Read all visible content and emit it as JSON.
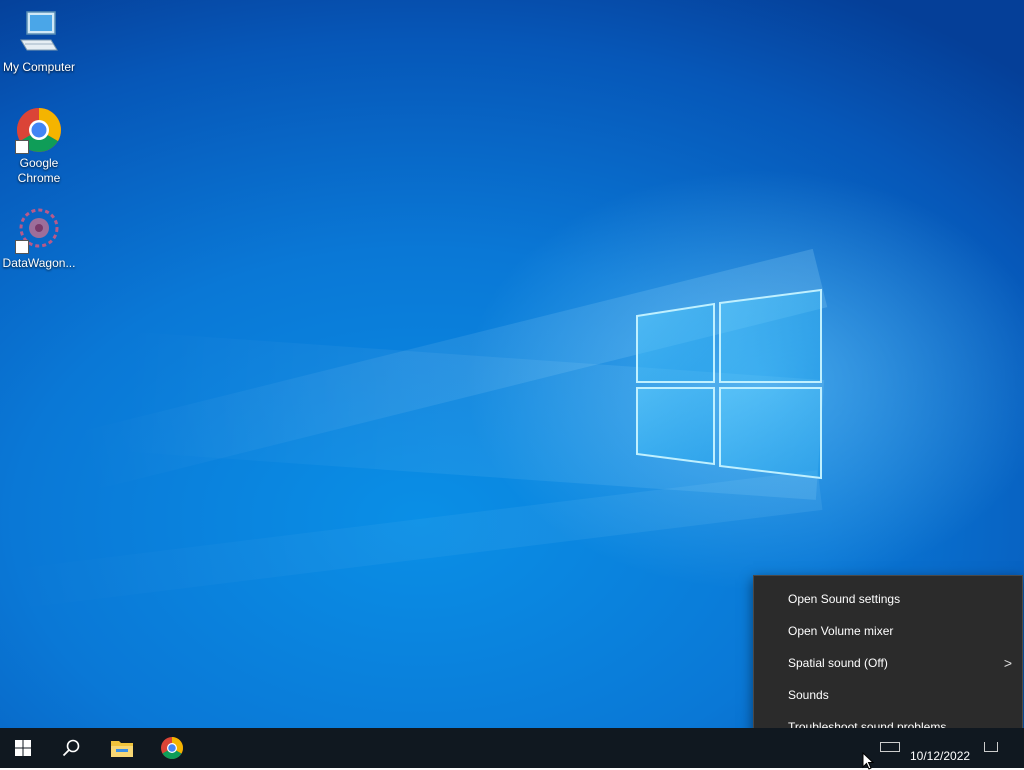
{
  "desktop": {
    "icons": [
      {
        "label": "My Computer",
        "icon": "computer-icon"
      },
      {
        "label": "Google Chrome",
        "icon": "chrome-icon"
      },
      {
        "label": "DataWagon...",
        "icon": "datawagon-icon"
      }
    ]
  },
  "context_menu": {
    "items": [
      {
        "label": "Open Sound settings"
      },
      {
        "label": "Open Volume mixer"
      },
      {
        "label": "Spatial sound (Off)",
        "submenu_arrow": ">"
      },
      {
        "label": "Sounds"
      },
      {
        "label": "Troubleshoot sound problems"
      }
    ]
  },
  "taskbar": {
    "buttons": [
      "start-icon",
      "search-icon",
      "file-explorer-icon",
      "chrome-icon"
    ],
    "clock_date": "10/12/2022"
  },
  "colors": {
    "taskbar": "#101820",
    "menu_bg": "#2b2b2b",
    "wallpaper": "#0a78d6"
  }
}
